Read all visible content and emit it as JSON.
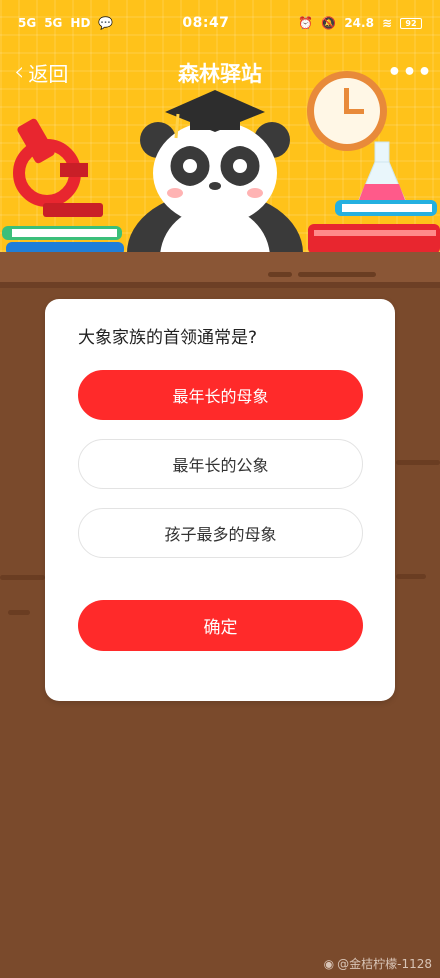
{
  "status_bar": {
    "left_icons": [
      "5G",
      "5G",
      "HD"
    ],
    "time": "08:47",
    "speed": "24.8",
    "battery": "92"
  },
  "nav": {
    "back_label": "返回",
    "title": "森林驿站",
    "more": "•••"
  },
  "quiz": {
    "question": "大象家族的首领通常是?",
    "options": [
      {
        "label": "最年长的母象",
        "selected": true
      },
      {
        "label": "最年长的公象",
        "selected": false
      },
      {
        "label": "孩子最多的母象",
        "selected": false
      }
    ],
    "confirm_label": "确定"
  },
  "watermark": "@金桔柠檬-1128",
  "colors": {
    "banner": "#ffc21a",
    "accent_red": "#ff2a2a",
    "background_brown": "#7a4a2c"
  }
}
